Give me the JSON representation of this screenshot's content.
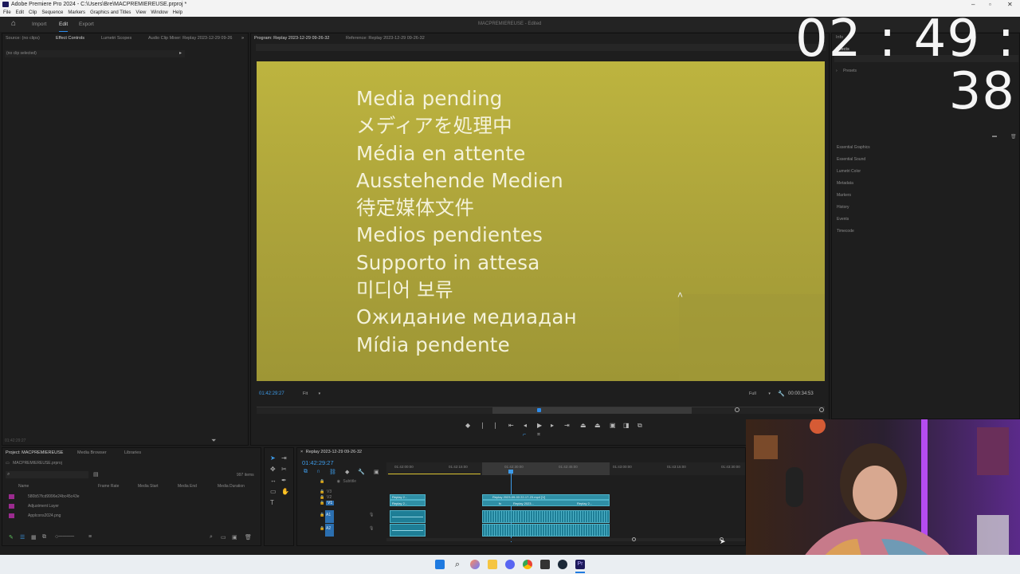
{
  "window": {
    "title": "Adobe Premiere Pro 2024 - C:\\Users\\Bre\\MACPREMIEREUSE.prproj *"
  },
  "menu": [
    "File",
    "Edit",
    "Clip",
    "Sequence",
    "Markers",
    "Graphics and Titles",
    "View",
    "Window",
    "Help"
  ],
  "workspaces": {
    "import": "Import",
    "edit": "Edit",
    "export": "Export"
  },
  "app_title": {
    "name": "MACPREMIEREUSE",
    "state": "- Edited"
  },
  "left_panel": {
    "tabs": [
      "Source: (no clips)",
      "Effect Controls",
      "Lumetri Scopes",
      "Audio Clip Mixer: Replay 2023-12-29 09-26"
    ],
    "no_clip": "(no clip selected)",
    "timecode": "01:42:29:27"
  },
  "program": {
    "tab": "Program: Replay 2023-12-29 09-26-32",
    "ref_tab": "Reference: Replay 2023-12-29 09-26-32",
    "pending_lines": [
      "Media pending",
      "メディアを処理中",
      "Média en attente",
      "Ausstehende Medien",
      "待定媒体文件",
      "Medios pendientes",
      "Supporto in attesa",
      "미디어 보류",
      "Ожидание медиадан",
      "Mídia pendente"
    ],
    "timecode": "01:42:29:27",
    "fit": "Fit",
    "resolution": "Full",
    "duration": "00:00:34:53"
  },
  "right_panel": {
    "tabs": [
      "Info",
      "Effects"
    ],
    "presets": "Presets",
    "items": [
      "Essential Graphics",
      "Essential Sound",
      "Lumetri Color",
      "Metadata",
      "Markers",
      "History",
      "Events",
      "Timecode"
    ]
  },
  "overlay_clock": "02 : 49 : 38",
  "project": {
    "tabs": [
      "Project: MACPREMIEREUSE",
      "Media Browser",
      "Libraries"
    ],
    "file": "MACPREMIEREUSE.prproj",
    "count": "997 items",
    "columns": [
      "Name",
      "Frame Rate",
      "Media Start",
      "Media End",
      "Media Duration"
    ],
    "rows": [
      "580b57fcd9996e24bc45c43e",
      "Adjustment Layer",
      "Applcons2024.png"
    ]
  },
  "timeline": {
    "tab": "Replay 2023-12-29 09-26-32",
    "timecode": "01:42:29:27",
    "ruler": [
      "01:42:00:00",
      "01:42:15:00",
      "01:42:30:00",
      "01:42:45:00",
      "01:43:00:00",
      "01:43:15:00",
      "01:43:30:00"
    ],
    "subtitle": "Subtitle",
    "tracks": [
      "V3",
      "V2",
      "V1",
      "A1",
      "A2"
    ],
    "clip_a": "Replay 2...",
    "clip_b": "Replay 2023-09-03 22-17-23.mp4 [V]",
    "clip_c": "Replay 2023...",
    "clip_d": "Replay 2...",
    "fx": "fx"
  },
  "colors": {
    "accent": "#2d8ceb",
    "clip": "#2f8fa6",
    "monitor": "#b3aa3c"
  }
}
